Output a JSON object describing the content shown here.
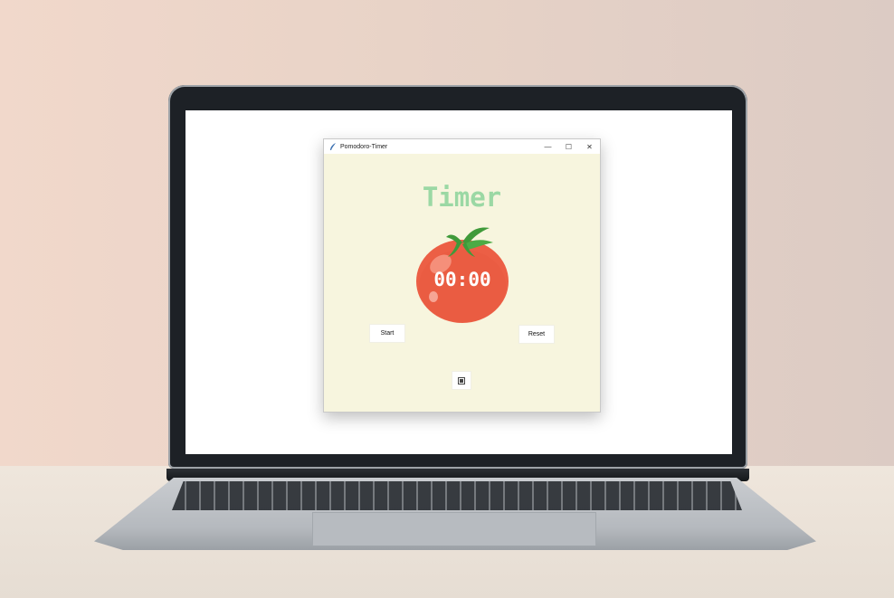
{
  "window": {
    "title": "Pomodoro-Timer",
    "controls": {
      "minimize": "—",
      "maximize": "☐",
      "close": "✕"
    }
  },
  "app": {
    "heading": "Timer",
    "time_display": "00:00",
    "start_label": "Start",
    "reset_label": "Reset",
    "checkmark": "",
    "colors": {
      "background": "#f7f5de",
      "heading": "#9bd8a4",
      "tomato": "#ec5f45",
      "leaf": "#3f9a3a"
    }
  },
  "icons": {
    "app_icon": "feather-icon",
    "tomato": "tomato-image"
  }
}
